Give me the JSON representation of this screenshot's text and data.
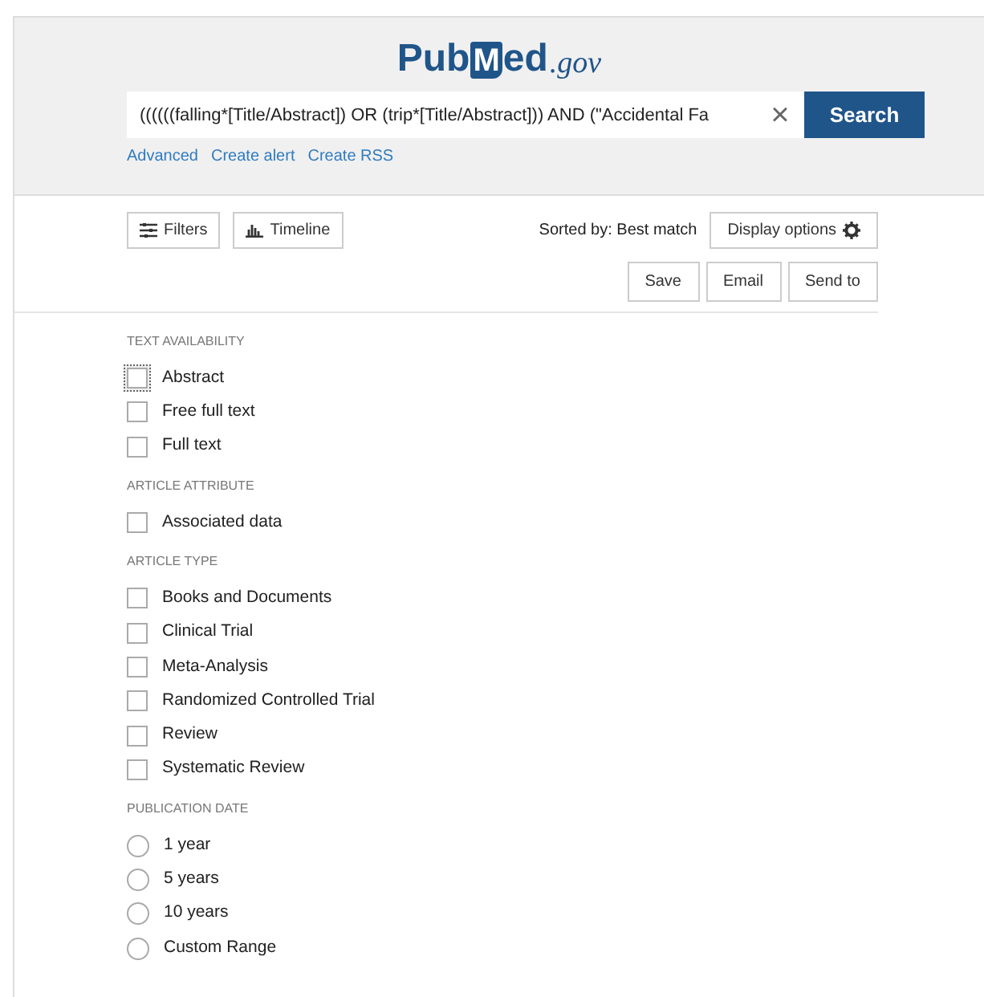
{
  "logo": {
    "prefix": "Pub",
    "mark": "M",
    "rest": "ed",
    "suffix": ".gov"
  },
  "search": {
    "value": "((((((falling*[Title/Abstract]) OR (trip*[Title/Abstract])) AND (\"Accidental Fa",
    "clear": "×",
    "button": "Search"
  },
  "search_links": [
    "Advanced",
    "Create alert",
    "Create RSS"
  ],
  "toolbar": {
    "filters": "Filters",
    "timeline": "Timeline",
    "sorted_by": "Sorted by: Best match",
    "display_options": "Display options"
  },
  "actions": [
    "Save",
    "Email",
    "Send to"
  ],
  "filter_groups": [
    {
      "title": "TEXT AVAILABILITY",
      "kind": "checkbox",
      "items": [
        {
          "label": "Abstract",
          "checked": false,
          "focused": true
        },
        {
          "label": "Free full text",
          "checked": false,
          "focused": false
        },
        {
          "label": "Full text",
          "checked": false,
          "focused": false
        }
      ]
    },
    {
      "title": "ARTICLE ATTRIBUTE",
      "kind": "checkbox",
      "items": [
        {
          "label": "Associated data",
          "checked": false,
          "focused": false
        }
      ]
    },
    {
      "title": "ARTICLE TYPE",
      "kind": "checkbox",
      "items": [
        {
          "label": "Books and Documents",
          "checked": false,
          "focused": false
        },
        {
          "label": "Clinical Trial",
          "checked": false,
          "focused": false
        },
        {
          "label": "Meta-Analysis",
          "checked": false,
          "focused": false
        },
        {
          "label": "Randomized Controlled Trial",
          "checked": false,
          "focused": false
        },
        {
          "label": "Review",
          "checked": false,
          "focused": false
        },
        {
          "label": "Systematic Review",
          "checked": false,
          "focused": false
        }
      ]
    },
    {
      "title": "PUBLICATION DATE",
      "kind": "radio",
      "items": [
        {
          "label": "1 year",
          "selected": false,
          "focused": false
        },
        {
          "label": "5 years",
          "selected": false,
          "focused": false
        },
        {
          "label": "10 years",
          "selected": false,
          "focused": false
        },
        {
          "label": "Custom Range",
          "selected": false,
          "focused": false
        }
      ]
    }
  ]
}
